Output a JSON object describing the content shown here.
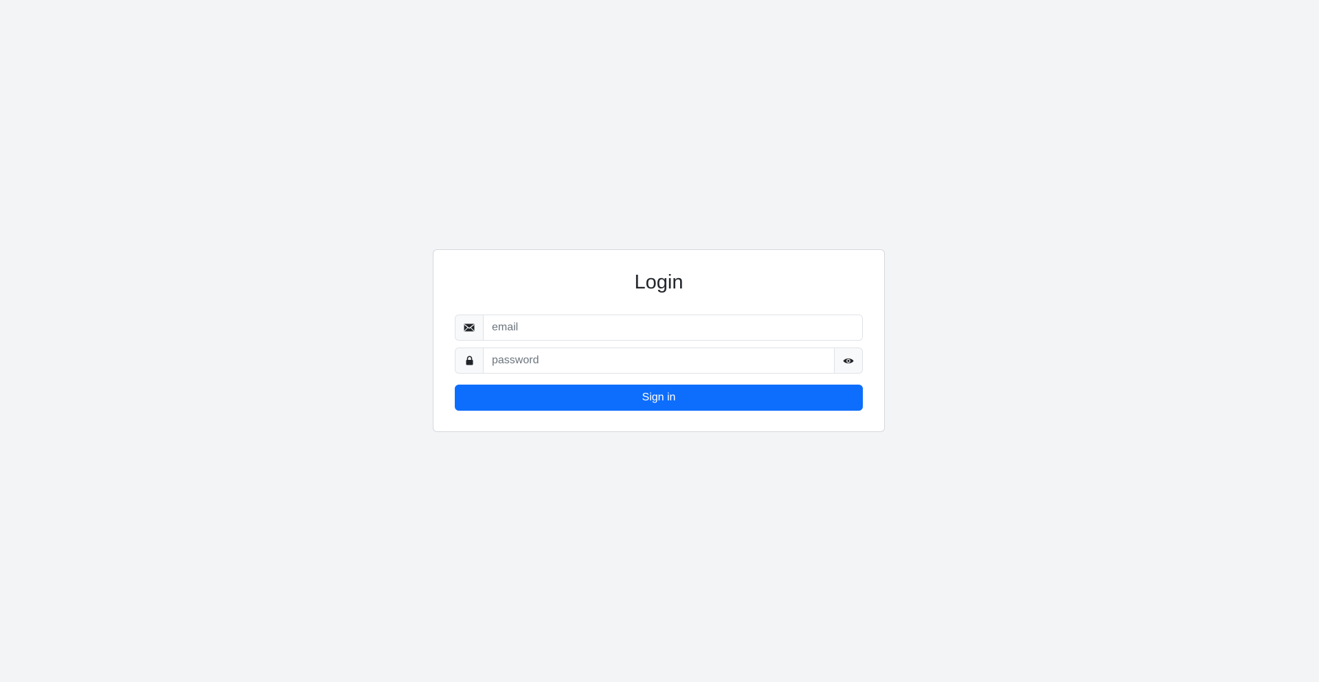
{
  "login": {
    "title": "Login",
    "email": {
      "icon": "envelope-icon",
      "placeholder": "email",
      "value": ""
    },
    "password": {
      "icon": "lock-icon",
      "placeholder": "password",
      "value": "",
      "toggle_icon": "eye-icon"
    },
    "submit_label": "Sign in"
  },
  "colors": {
    "background": "#f3f4f6",
    "card": "#ffffff",
    "primary": "#0d6efd",
    "border": "#dee2e6",
    "addon_bg": "#f8f9fa"
  }
}
